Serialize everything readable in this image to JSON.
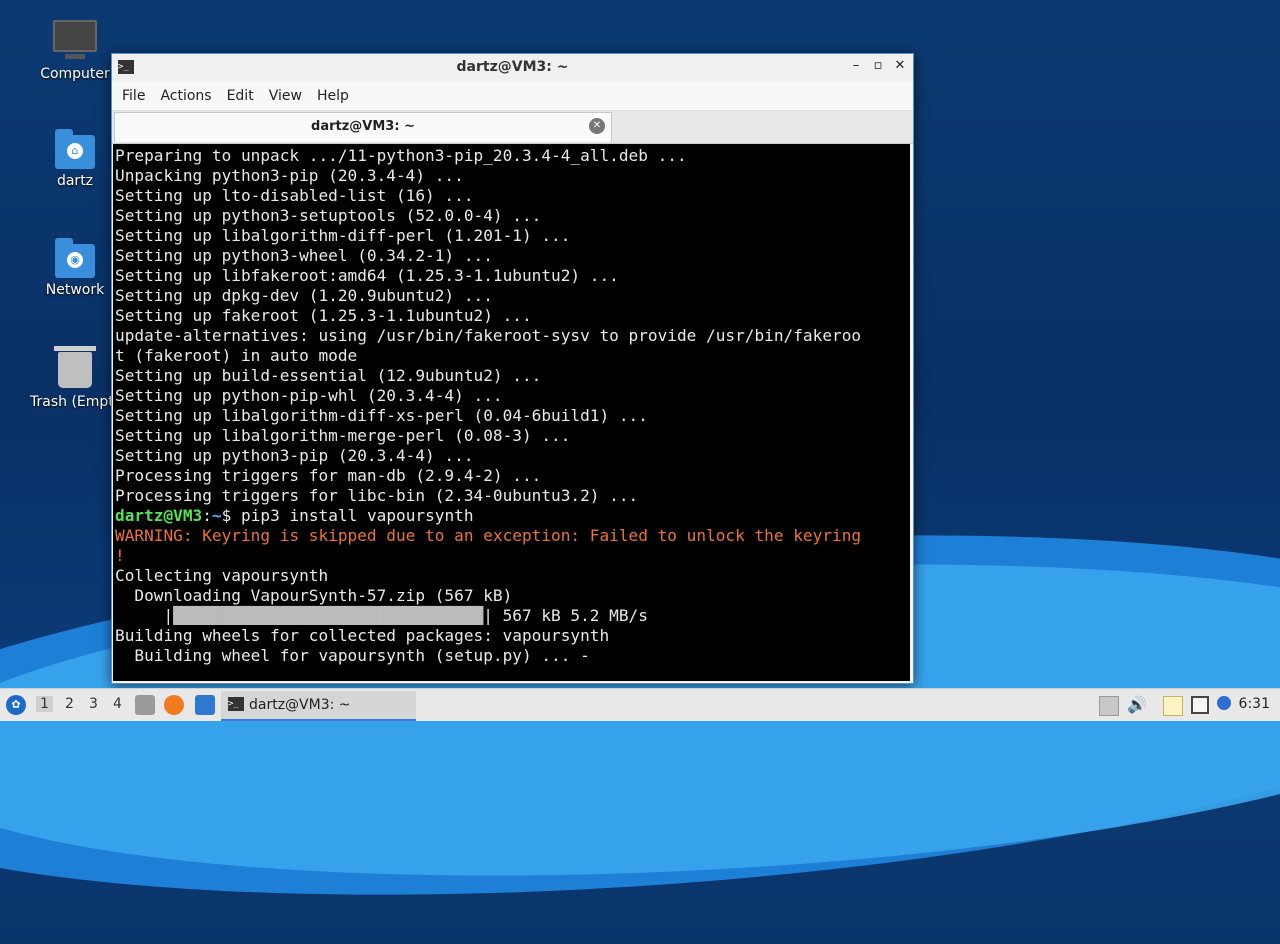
{
  "desktop": {
    "icons": [
      {
        "label": "Computer"
      },
      {
        "label": "dartz"
      },
      {
        "label": "Network"
      },
      {
        "label": "Trash (Empty)"
      }
    ]
  },
  "window": {
    "title": "dartz@VM3: ~",
    "controls": {
      "minimize": "–",
      "maximize": "▫",
      "close": "✕"
    },
    "menu": [
      "File",
      "Actions",
      "Edit",
      "View",
      "Help"
    ],
    "tab": {
      "label": "dartz@VM3: ~",
      "close": "✕"
    }
  },
  "terminal": {
    "lines": [
      "Preparing to unpack .../11-python3-pip_20.3.4-4_all.deb ...",
      "Unpacking python3-pip (20.3.4-4) ...",
      "Setting up lto-disabled-list (16) ...",
      "Setting up python3-setuptools (52.0.0-4) ...",
      "Setting up libalgorithm-diff-perl (1.201-1) ...",
      "Setting up python3-wheel (0.34.2-1) ...",
      "Setting up libfakeroot:amd64 (1.25.3-1.1ubuntu2) ...",
      "Setting up dpkg-dev (1.20.9ubuntu2) ...",
      "Setting up fakeroot (1.25.3-1.1ubuntu2) ...",
      "update-alternatives: using /usr/bin/fakeroot-sysv to provide /usr/bin/fakeroo",
      "t (fakeroot) in auto mode",
      "Setting up build-essential (12.9ubuntu2) ...",
      "Setting up python-pip-whl (20.3.4-4) ...",
      "Setting up libalgorithm-diff-xs-perl (0.04-6build1) ...",
      "Setting up libalgorithm-merge-perl (0.08-3) ...",
      "Setting up python3-pip (20.3.4-4) ...",
      "Processing triggers for man-db (2.9.4-2) ...",
      "Processing triggers for libc-bin (2.34-0ubuntu3.2) ..."
    ],
    "prompt": {
      "user": "dartz@VM3",
      "sep": ":",
      "path": "~",
      "symbol": "$",
      "command": " pip3 install vapoursynth"
    },
    "warning1": "WARNING: Keyring is skipped due to an exception: Failed to unlock the keyring",
    "warning2": "!",
    "after": [
      "Collecting vapoursynth",
      "  Downloading VapourSynth-57.zip (567 kB)"
    ],
    "progress": {
      "prefix": "     |",
      "bar": "████████████████████████████████",
      "suffix": "| 567 kB 5.2 MB/s"
    },
    "tail": [
      "Building wheels for collected packages: vapoursynth",
      "  Building wheel for vapoursynth (setup.py) ... -"
    ]
  },
  "taskbar": {
    "workspaces": [
      "1",
      "2",
      "3",
      "4"
    ],
    "task_label": "dartz@VM3: ~",
    "clock": "6:31"
  },
  "colors": {
    "accent": "#3a7bd5",
    "prompt_user": "#55e255",
    "prompt_path": "#5fa8ff",
    "warning": "#e8743b"
  }
}
